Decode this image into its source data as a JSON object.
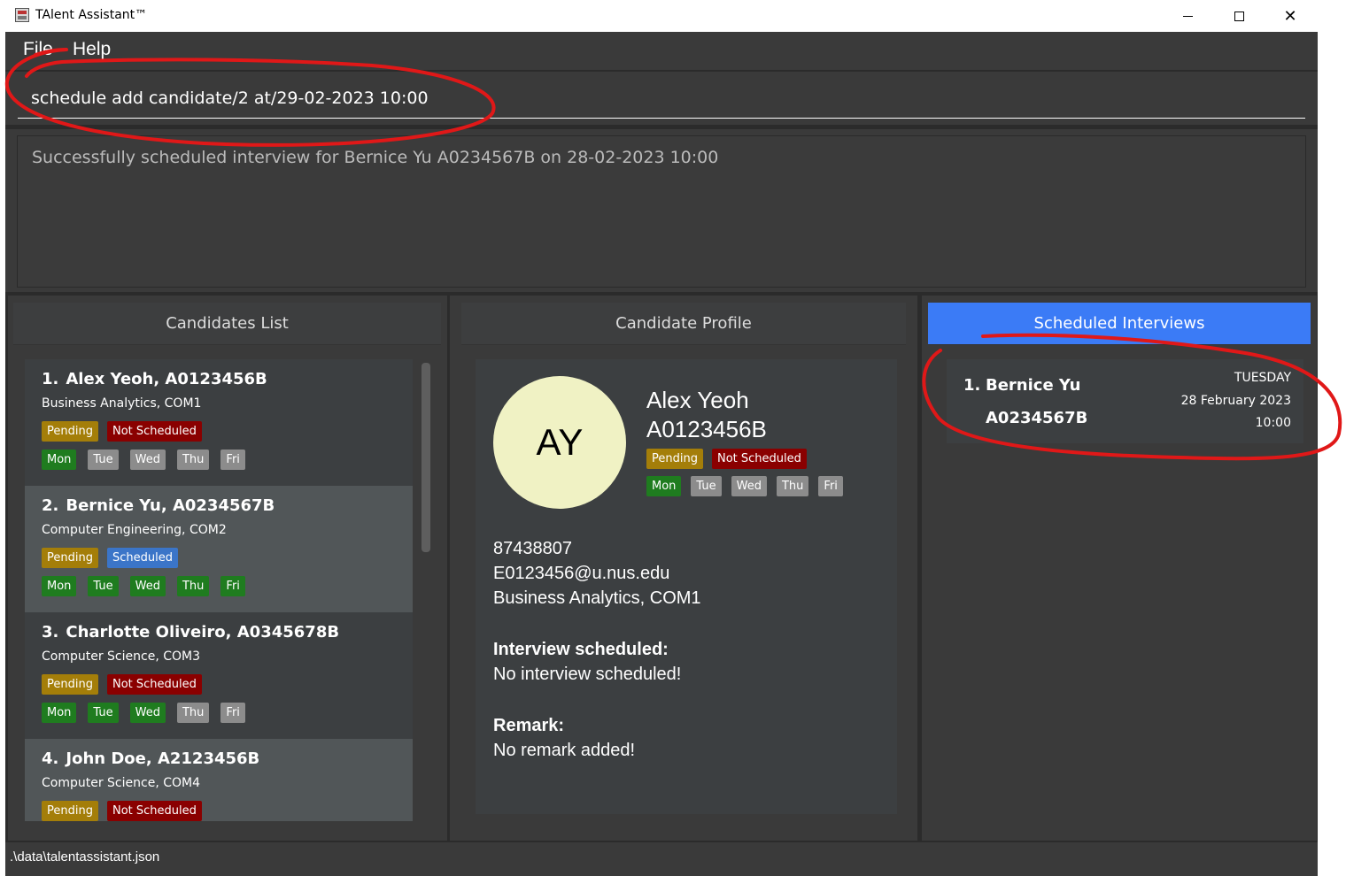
{
  "window": {
    "title": "TAlent Assistant™",
    "minimize": "",
    "maximize": "",
    "close": "✕"
  },
  "menu": {
    "file": "File",
    "help": "Help"
  },
  "command": {
    "value": "schedule add candidate/2 at/29-02-2023 10:00"
  },
  "result": {
    "message": "Successfully scheduled interview for Bernice Yu A0234567B on 28-02-2023 10:00"
  },
  "candidates": {
    "header": "Candidates List",
    "items": [
      {
        "num": "1.",
        "name": "Alex Yeoh, A0123456B",
        "course": "Business Analytics, COM1",
        "status": "Pending",
        "schedule": "Not Scheduled",
        "days": [
          {
            "label": "Mon",
            "on": true
          },
          {
            "label": "Tue",
            "on": false
          },
          {
            "label": "Wed",
            "on": false
          },
          {
            "label": "Thu",
            "on": false
          },
          {
            "label": "Fri",
            "on": false
          }
        ]
      },
      {
        "num": "2.",
        "name": "Bernice Yu, A0234567B",
        "course": "Computer Engineering, COM2",
        "status": "Pending",
        "schedule": "Scheduled",
        "days": [
          {
            "label": "Mon",
            "on": true
          },
          {
            "label": "Tue",
            "on": true
          },
          {
            "label": "Wed",
            "on": true
          },
          {
            "label": "Thu",
            "on": true
          },
          {
            "label": "Fri",
            "on": true
          }
        ]
      },
      {
        "num": "3.",
        "name": "Charlotte Oliveiro, A0345678B",
        "course": "Computer Science, COM3",
        "status": "Pending",
        "schedule": "Not Scheduled",
        "days": [
          {
            "label": "Mon",
            "on": true
          },
          {
            "label": "Tue",
            "on": true
          },
          {
            "label": "Wed",
            "on": true
          },
          {
            "label": "Thu",
            "on": false
          },
          {
            "label": "Fri",
            "on": false
          }
        ]
      },
      {
        "num": "4.",
        "name": "John Doe, A2123456B",
        "course": "Computer Science, COM4",
        "status": "Pending",
        "schedule": "Not Scheduled",
        "days": []
      }
    ]
  },
  "profile": {
    "header": "Candidate Profile",
    "initials": "AY",
    "name": "Alex Yeoh",
    "id": "A0123456B",
    "status": "Pending",
    "schedule": "Not Scheduled",
    "days": [
      {
        "label": "Mon",
        "on": true
      },
      {
        "label": "Tue",
        "on": false
      },
      {
        "label": "Wed",
        "on": false
      },
      {
        "label": "Thu",
        "on": false
      },
      {
        "label": "Fri",
        "on": false
      }
    ],
    "phone": "87438807",
    "email": "E0123456@u.nus.edu",
    "course": "Business Analytics, COM1",
    "interview_title": "Interview scheduled:",
    "interview_value": "No interview scheduled!",
    "remark_title": "Remark:",
    "remark_value": "No remark added!"
  },
  "interviews": {
    "header": "Scheduled Interviews",
    "items": [
      {
        "num": "1.",
        "name": "Bernice Yu",
        "id": "A0234567B",
        "day": "TUESDAY",
        "date": "28 February 2023",
        "time": "10:00"
      }
    ]
  },
  "status": {
    "path": ".\\data\\talentassistant.json"
  },
  "colors": {
    "accent": "#3b7bf6",
    "pending": "#a47e09",
    "not_scheduled": "#8a0000",
    "scheduled": "#3b75c8",
    "day_on": "#1f7c1f",
    "day_off": "#8c8c8c",
    "annotation": "#e01818"
  }
}
